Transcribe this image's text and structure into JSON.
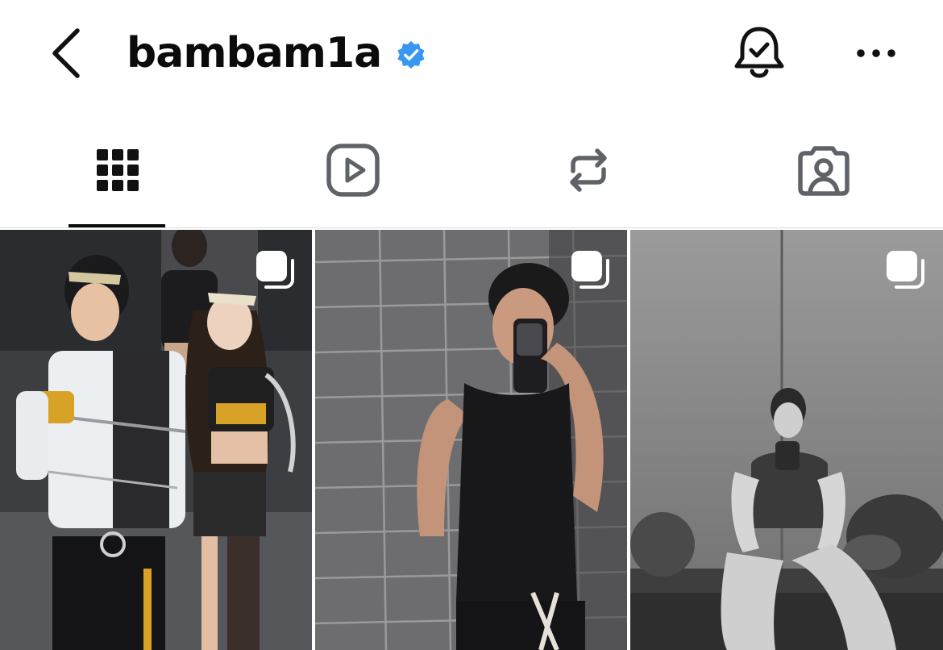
{
  "header": {
    "username": "bambam1a",
    "verified": true,
    "back_icon": "chevron-left-icon",
    "notification_icon": "bell-check-icon",
    "more_icon": "more-horizontal-icon"
  },
  "tabs": [
    {
      "id": "posts",
      "icon": "grid-icon",
      "active": true
    },
    {
      "id": "reels",
      "icon": "reels-play-icon",
      "active": false
    },
    {
      "id": "reposts",
      "icon": "repost-icon",
      "active": false
    },
    {
      "id": "tagged",
      "icon": "tagged-person-icon",
      "active": false
    }
  ],
  "grid": {
    "posts": [
      {
        "id": "post-1",
        "type": "carousel",
        "style": "color"
      },
      {
        "id": "post-2",
        "type": "carousel",
        "style": "color"
      },
      {
        "id": "post-3",
        "type": "carousel",
        "style": "monochrome"
      }
    ]
  },
  "colors": {
    "text": "#0b0b0b",
    "verified_badge": "#3897f0",
    "icon_gray": "#5f6368",
    "divider": "#dcdcdc"
  }
}
